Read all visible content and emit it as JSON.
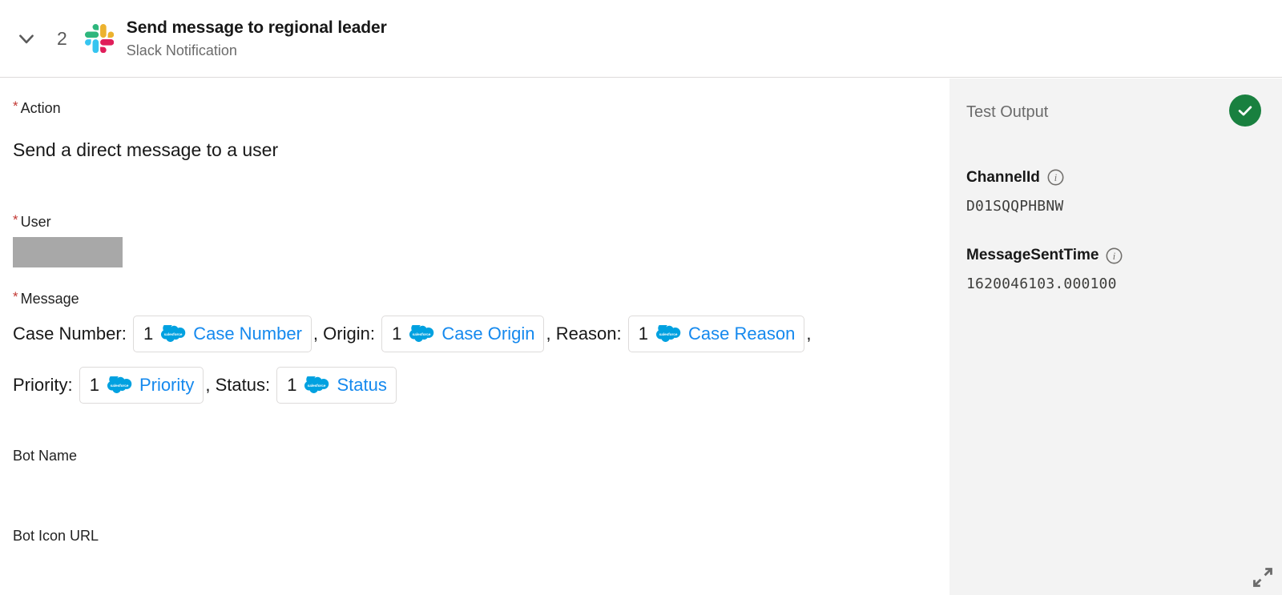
{
  "colors": {
    "accent_blue": "#1589ee",
    "salesforce_cloud": "#00a1e0",
    "required_star": "#c23934",
    "success_green": "#19803f",
    "panel_background": "#f3f3f3",
    "redaction_gray": "#a8a8a8",
    "border_gray": "#dddbda"
  },
  "header": {
    "collapse_icon": "chevron-down-icon",
    "step_number": "2",
    "app_icon": "slack-icon",
    "title": "Send message to regional leader",
    "subtitle": "Slack Notification"
  },
  "form": {
    "action": {
      "label": "Action",
      "required_marker": "*",
      "value": "Send a direct message to a user"
    },
    "user": {
      "label": "User",
      "required_marker": "*",
      "value": ""
    },
    "message": {
      "label": "Message",
      "required_marker": "*",
      "segments": [
        {
          "kind": "text",
          "text": "Case Number: "
        },
        {
          "kind": "token",
          "index": "1",
          "icon": "salesforce-icon",
          "name": "Case Number"
        },
        {
          "kind": "text",
          "text": ", Origin: "
        },
        {
          "kind": "token",
          "index": "1",
          "icon": "salesforce-icon",
          "name": "Case Origin"
        },
        {
          "kind": "text",
          "text": ", Reason: "
        },
        {
          "kind": "token",
          "index": "1",
          "icon": "salesforce-icon",
          "name": "Case Reason"
        },
        {
          "kind": "text",
          "text": ","
        },
        {
          "kind": "break"
        },
        {
          "kind": "text",
          "text": "Priority: "
        },
        {
          "kind": "token",
          "index": "1",
          "icon": "salesforce-icon",
          "name": "Priority"
        },
        {
          "kind": "text",
          "text": ", Status: "
        },
        {
          "kind": "token",
          "index": "1",
          "icon": "salesforce-icon",
          "name": "Status"
        }
      ]
    },
    "bot_name": {
      "label": "Bot Name",
      "value": ""
    },
    "bot_icon_url": {
      "label": "Bot Icon URL",
      "value": ""
    }
  },
  "output": {
    "title": "Test Output",
    "status_icon": "check-circle-icon",
    "fields": [
      {
        "key": "ChannelId",
        "info_icon": "info-icon",
        "value": "D01SQQPHBNW"
      },
      {
        "key": "MessageSentTime",
        "info_icon": "info-icon",
        "value": "1620046103.000100"
      }
    ]
  },
  "resize_handle": {
    "icon": "expand-diagonal-icon"
  }
}
